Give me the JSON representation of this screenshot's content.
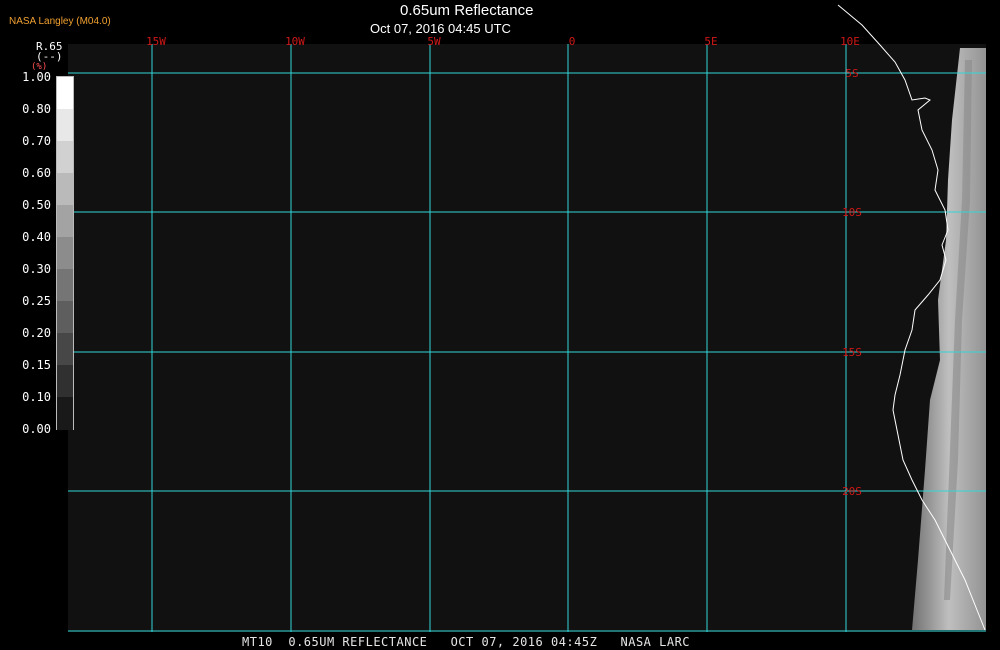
{
  "header": {
    "credit": "NASA Langley (M04.0)",
    "title": "0.65um Reflectance",
    "subtitle": "Oct 07, 2016 04:45 UTC"
  },
  "colorbar": {
    "title": "R.65",
    "unit_line": "(--)",
    "unit_small": "(%)",
    "ticks": [
      "1.00",
      "0.80",
      "0.70",
      "0.60",
      "0.50",
      "0.40",
      "0.30",
      "0.25",
      "0.20",
      "0.15",
      "0.10",
      "0.00"
    ]
  },
  "map": {
    "longitude_labels": [
      "15W",
      "10W",
      "5W",
      "0",
      "5E",
      "10E"
    ],
    "latitude_labels": [
      "5S",
      "10S",
      "15S",
      "20S"
    ],
    "grid_color": "#33d6d6",
    "label_color": "#d01818",
    "background_color": "#111111",
    "coast_color": "#ffffff"
  },
  "footer": {
    "text": "MT10  0.65UM REFLECTANCE   OCT 07, 2016 04:45Z   NASA LARC"
  }
}
